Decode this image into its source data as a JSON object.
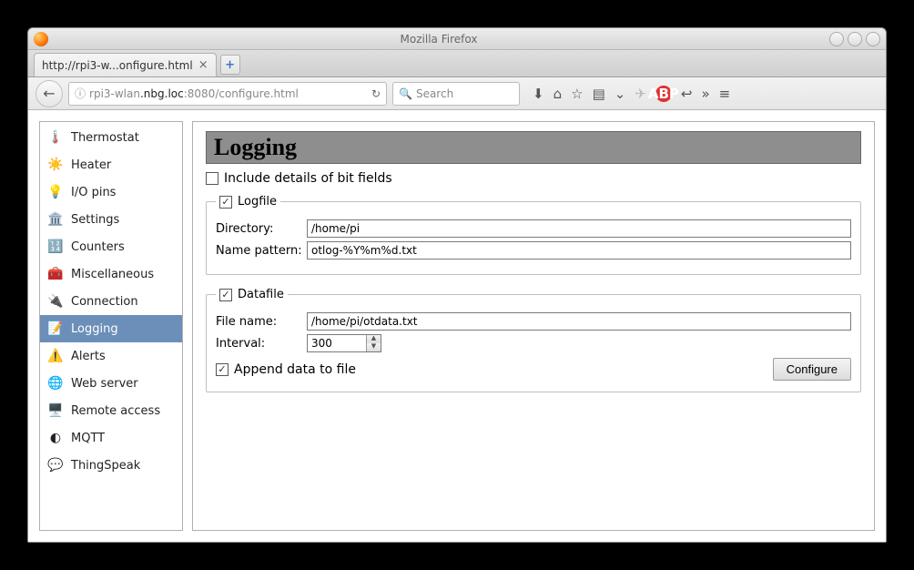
{
  "window": {
    "title": "Mozilla Firefox"
  },
  "tab": {
    "label": "http://rpi3-w...onfigure.html"
  },
  "url": {
    "prefix": "rpi3-wlan",
    "highlight": ".nbg.loc",
    "suffix": ":8080/configure.html"
  },
  "search": {
    "placeholder": "Search"
  },
  "abp": "ABP",
  "sidebar": {
    "items": [
      {
        "label": "Thermostat",
        "icon": "🌡️"
      },
      {
        "label": "Heater",
        "icon": "☀️"
      },
      {
        "label": "I/O pins",
        "icon": "💡"
      },
      {
        "label": "Settings",
        "icon": "🏛️"
      },
      {
        "label": "Counters",
        "icon": "🔢"
      },
      {
        "label": "Miscellaneous",
        "icon": "🧰"
      },
      {
        "label": "Connection",
        "icon": "🔌"
      },
      {
        "label": "Logging",
        "icon": "📝",
        "active": true
      },
      {
        "label": "Alerts",
        "icon": "⚠️"
      },
      {
        "label": "Web server",
        "icon": "🌐"
      },
      {
        "label": "Remote access",
        "icon": "🖥️"
      },
      {
        "label": "MQTT",
        "icon": "◐"
      },
      {
        "label": "ThingSpeak",
        "icon": "💬"
      }
    ]
  },
  "page": {
    "heading": "Logging",
    "include_details": {
      "label": "Include details of bit fields",
      "checked": false
    },
    "logfile": {
      "legend": "Logfile",
      "enabled": true,
      "dir_label": "Directory:",
      "dir_value": "/home/pi",
      "pattern_label": "Name pattern:",
      "pattern_value": "otlog-%Y%m%d.txt"
    },
    "datafile": {
      "legend": "Datafile",
      "enabled": true,
      "file_label": "File name:",
      "file_value": "/home/pi/otdata.txt",
      "interval_label": "Interval:",
      "interval_value": "300",
      "append": {
        "label": "Append data to file",
        "checked": true
      },
      "button": "Configure"
    }
  }
}
